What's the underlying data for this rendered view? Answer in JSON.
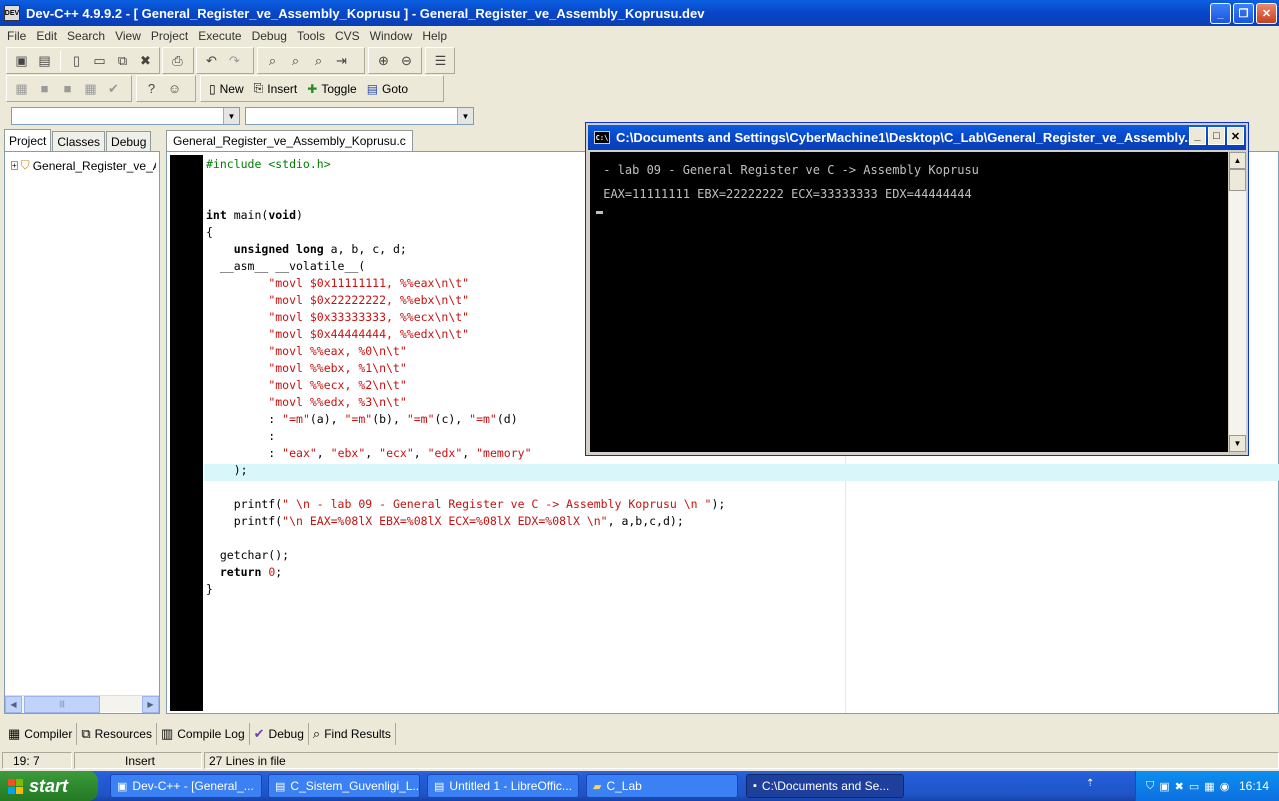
{
  "window": {
    "icon_label": "DEV",
    "title": "Dev-C++ 4.9.9.2  -  [ General_Register_ve_Assembly_Koprusu ] - General_Register_ve_Assembly_Koprusu.dev"
  },
  "menu": [
    "File",
    "Edit",
    "Search",
    "View",
    "Project",
    "Execute",
    "Debug",
    "Tools",
    "CVS",
    "Window",
    "Help"
  ],
  "toolbar2": {
    "new_label": "New",
    "insert_label": "Insert",
    "toggle_label": "Toggle",
    "goto_label": "Goto"
  },
  "left_panel": {
    "tabs": [
      "Project",
      "Classes",
      "Debug"
    ],
    "tree_item": "General_Register_ve_Assembly_Koprusu"
  },
  "editor": {
    "tab_label": "General_Register_ve_Assembly_Koprusu.c",
    "lines": [
      "#include <stdio.h>",
      "",
      "",
      "int main(void)",
      "{",
      "    unsigned long a, b, c, d;",
      "  __asm__ __volatile__(",
      "         \"movl $0x11111111, %%eax\\n\\t\"",
      "         \"movl $0x22222222, %%ebx\\n\\t\"",
      "         \"movl $0x33333333, %%ecx\\n\\t\"",
      "         \"movl $0x44444444, %%edx\\n\\t\"",
      "         \"movl %%eax, %0\\n\\t\"",
      "         \"movl %%ebx, %1\\n\\t\"",
      "         \"movl %%ecx, %2\\n\\t\"",
      "         \"movl %%edx, %3\\n\\t\"",
      "         : \"=m\"(a), \"=m\"(b), \"=m\"(c), \"=m\"(d)",
      "         :",
      "         : \"eax\", \"ebx\", \"ecx\", \"edx\", \"memory\"",
      "    );",
      "",
      "    printf(\" \\n - lab 09 - General Register ve C -> Assembly Koprusu \\n \");",
      "    printf(\"\\n EAX=%08lX EBX=%08lX ECX=%08lX EDX=%08lX \\n\", a,b,c,d);",
      "",
      "  getchar();",
      "  return 0;",
      "}"
    ]
  },
  "console": {
    "icon_label": "C:\\",
    "title": "C:\\Documents and Settings\\CyberMachine1\\Desktop\\C_Lab\\General_Register_ve_Assembly...",
    "output": [
      " - lab 09 - General Register ve C -> Assembly Koprusu",
      " EAX=11111111 EBX=22222222 ECX=33333333 EDX=44444444"
    ]
  },
  "bottom_tabs": [
    "Compiler",
    "Resources",
    "Compile Log",
    "Debug",
    "Find Results"
  ],
  "status": {
    "position": "19: 7",
    "mode": "Insert",
    "lines": "27 Lines in file"
  },
  "taskbar": {
    "start_label": "start",
    "tasks": [
      "Dev-C++ - [General_...",
      "C_Sistem_Guvenligi_L...",
      "Untitled 1 - LibreOffic...",
      "C_Lab",
      "C:\\Documents and Se..."
    ],
    "clock": "16:14"
  },
  "colors": {
    "titlebar": "#0846c8",
    "keyword": "#000000",
    "string": "#c81010",
    "preprocessor": "#008000",
    "highlight": "#d9f6fb",
    "taskbar": "#245edb",
    "start": "#2f8a2f"
  }
}
